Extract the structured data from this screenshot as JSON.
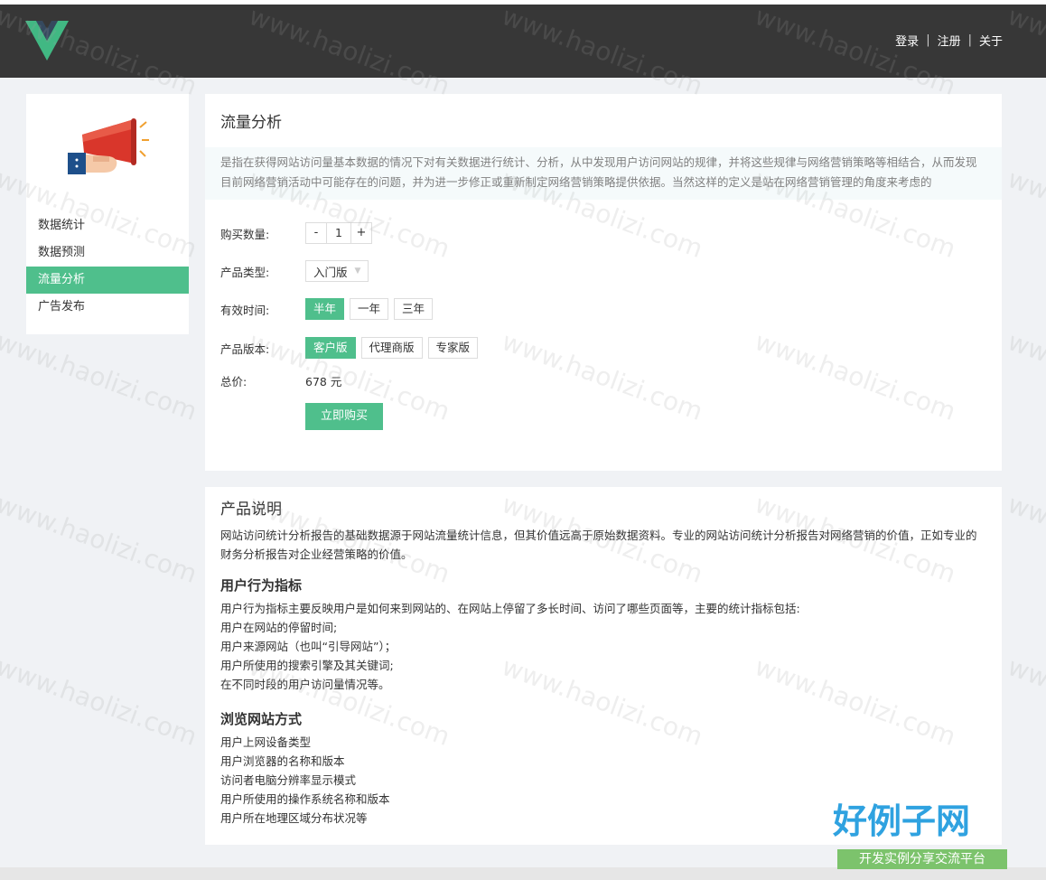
{
  "header": {
    "nav": [
      "登录",
      "注册",
      "关于"
    ],
    "separator": "|"
  },
  "sidebar": {
    "items": [
      {
        "label": "数据统计",
        "active": false
      },
      {
        "label": "数据预测",
        "active": false
      },
      {
        "label": "流量分析",
        "active": true
      },
      {
        "label": "广告发布",
        "active": false
      }
    ]
  },
  "product": {
    "title": "流量分析",
    "intro": "是指在获得网站访问量基本数据的情况下对有关数据进行统计、分析，从中发现用户访问网站的规律，并将这些规律与网络营销策略等相结合，从而发现目前网络营销活动中可能存在的问题，并为进一步修正或重新制定网络营销策略提供依据。当然这样的定义是站在网络营销管理的角度来考虑的",
    "quantity_label": "购买数量:",
    "quantity_minus": "-",
    "quantity_value": "1",
    "quantity_plus": "+",
    "type_label": "产品类型:",
    "type_value": "入门版",
    "duration_label": "有效时间:",
    "duration_options": [
      "半年",
      "一年",
      "三年"
    ],
    "duration_selected": 0,
    "version_label": "产品版本:",
    "version_options": [
      "客户版",
      "代理商版",
      "专家版"
    ],
    "version_selected": 0,
    "total_label": "总价:",
    "total_value": "678 元",
    "buy_label": "立即购买"
  },
  "description": {
    "title": "产品说明",
    "body": "网站访问统计分析报告的基础数据源于网站流量统计信息，但其价值远高于原始数据资料。专业的网站访问统计分析报告对网络营销的价值，正如专业的财务分析报告对企业经营策略的价值。",
    "section1_title": "用户行为指标",
    "section1_lines": [
      "用户行为指标主要反映用户是如何来到网站的、在网站上停留了多长时间、访问了哪些页面等，主要的统计指标包括:",
      "用户在网站的停留时间;",
      "用户来源网站（也叫“引导网站”）；",
      "用户所使用的搜索引擎及其关键词;",
      "在不同时段的用户访问量情况等。"
    ],
    "section2_title": "浏览网站方式",
    "section2_lines": [
      "用户上网设备类型",
      "用户浏览器的名称和版本",
      "访问者电脑分辨率显示模式",
      "用户所使用的操作系统名称和版本",
      "用户所在地理区域分布状况等"
    ]
  },
  "brand": {
    "name": "好例子网",
    "tagline": "开发实例分享交流平台"
  },
  "watermark": "www.haolizi.com",
  "colors": {
    "accent": "#4fbf8c",
    "header_bg": "#373737"
  }
}
